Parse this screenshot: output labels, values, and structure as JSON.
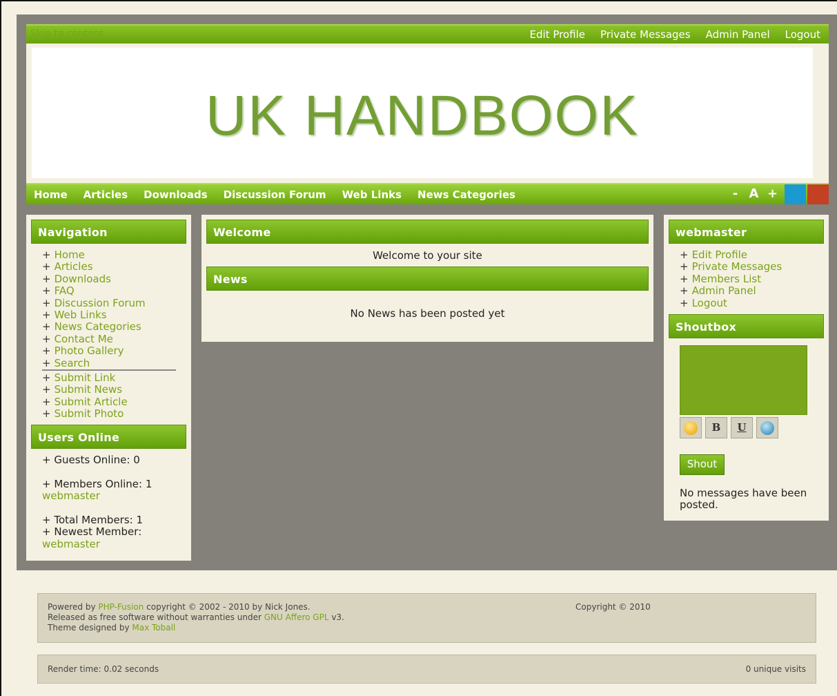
{
  "topbar": {
    "skip_link": "Skip to content",
    "user_menu": [
      "Edit Profile",
      "Private Messages",
      "Admin Panel",
      "Logout"
    ]
  },
  "banner": {
    "title": "UK HANDBOOK"
  },
  "mainnav": {
    "items": [
      "Home",
      "Articles",
      "Downloads",
      "Discussion Forum",
      "Web Links",
      "News Categories"
    ],
    "font_controls": [
      "-",
      "A",
      "+"
    ],
    "swatches": {
      "blue": "#1b9ad2",
      "red": "#c44023"
    }
  },
  "navigation": {
    "title": "Navigation",
    "items": [
      "Home",
      "Articles",
      "Downloads",
      "FAQ",
      "Discussion Forum",
      "Web Links",
      "News Categories",
      "Contact Me",
      "Photo Gallery",
      "Search"
    ],
    "submit_items": [
      "Submit Link",
      "Submit News",
      "Submit Article",
      "Submit Photo"
    ]
  },
  "users_online": {
    "title": "Users Online",
    "guests": "Guests Online: 0",
    "members": "Members Online: 1",
    "member_name": "webmaster",
    "total": "Total Members: 1",
    "newest": "Newest Member:",
    "newest_name": "webmaster"
  },
  "center": {
    "welcome_title": "Welcome",
    "welcome_text": "Welcome to your site",
    "news_title": "News",
    "news_text": "No News has been posted yet"
  },
  "user_panel": {
    "title": "webmaster",
    "items": [
      "Edit Profile",
      "Private Messages",
      "Members List",
      "Admin Panel",
      "Logout"
    ]
  },
  "shoutbox": {
    "title": "Shoutbox",
    "bbcode_buttons": [
      "B",
      "U"
    ],
    "shout_button": "Shout",
    "empty_text": "No messages have been posted."
  },
  "footer": {
    "powered_prefix": "Powered by ",
    "powered_link": "PHP-Fusion",
    "powered_suffix": " copyright © 2002 - 2010 by Nick Jones.",
    "released_prefix": "Released as free software without warranties under ",
    "released_link": "GNU Affero GPL",
    "released_suffix": " v3.",
    "theme_prefix": "Theme designed by ",
    "theme_link": "Max Toball",
    "copyright": "Copyright © 2010",
    "render_time": "Render time: 0.02 seconds",
    "visits": "0 unique visits"
  },
  "colors": {
    "accent_green": "#7aa21c",
    "background": "#f5f1e2",
    "frame_gray": "#84817a"
  }
}
